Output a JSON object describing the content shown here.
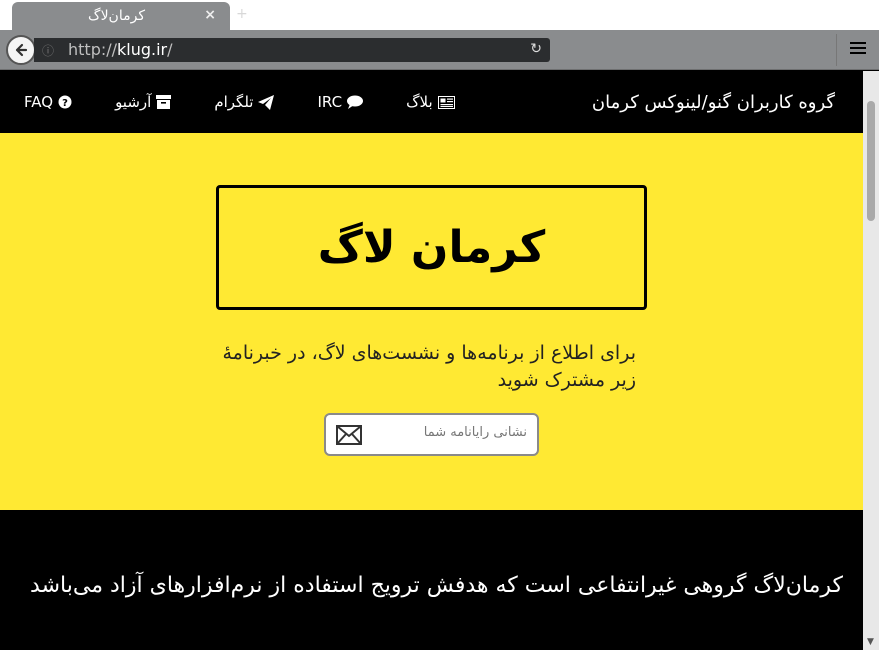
{
  "browser": {
    "tab_title": "کرمان‌لاگ",
    "tab_close": "×",
    "new_tab": "+",
    "url_scheme": "http://",
    "url_host": "klug.ir",
    "url_path": "/"
  },
  "navbar": {
    "brand": "گروه کاربران گنو/لینوکس کرمان",
    "items": [
      {
        "label": "FAQ",
        "icon": "question-circle-icon"
      },
      {
        "label": "آرشیو",
        "icon": "archive-icon"
      },
      {
        "label": "تلگرام",
        "icon": "paper-plane-icon"
      },
      {
        "label": "IRC",
        "icon": "comment-icon"
      },
      {
        "label": "بلاگ",
        "icon": "newspaper-icon"
      }
    ]
  },
  "hero": {
    "title": "کرمان لاگ",
    "subtitle": "برای اطلاع از برنامه‌ها و نشست‌های لاگ، در خبرنامهٔ زیر مشترک شوید",
    "email_placeholder": "نشانی رایانامه شما",
    "email_value": ""
  },
  "about": {
    "text": "کرمان‌لاگ گروهی غیرانتفاعی است که هدفش ترویج استفاده از نرم‌افزارهای آزاد می‌باشد"
  },
  "colors": {
    "hero_bg": "#ffe933",
    "navbar_bg": "#000000",
    "chrome_gray": "#8a8c8e"
  }
}
